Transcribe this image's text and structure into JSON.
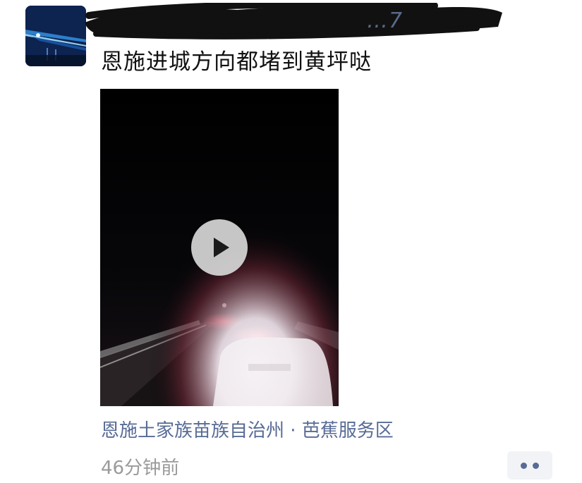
{
  "post": {
    "author_name_visible_fragment": "…7",
    "text": "恩施进城方向都堵到黄坪哒",
    "location": "恩施土家族苗族自治州 · 芭蕉服务区",
    "timestamp": "46分钟前"
  },
  "video": {
    "state": "paused",
    "play_icon": "play-icon"
  },
  "icons": {
    "avatar": "avatar-image",
    "more": "more-dots-icon"
  },
  "colors": {
    "link": "#576b95",
    "text": "#111111",
    "meta": "#9a9a9a",
    "more_bg": "#f2f3f6"
  }
}
